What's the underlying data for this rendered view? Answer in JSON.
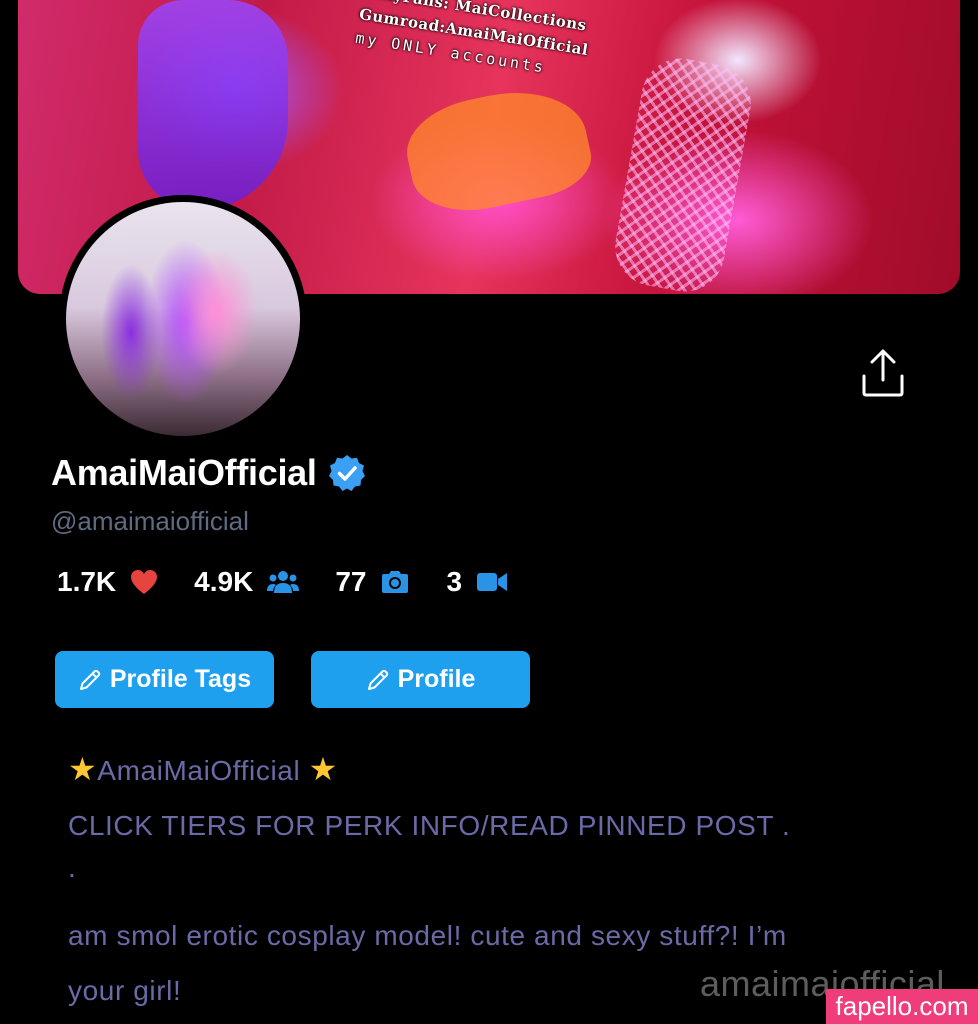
{
  "cover": {
    "lines": [
      "OnlyFans: MaiCollections",
      "Gumroad:AmaiMaiOfficial",
      "my ONLY accounts"
    ]
  },
  "profile": {
    "display_name": "AmaiMaiOfficial",
    "handle": "@amaimaiofficial",
    "verified": true
  },
  "stats": {
    "likes": "1.7K",
    "subscribers": "4.9K",
    "photos": "77",
    "videos": "3"
  },
  "buttons": {
    "profile_tags": "Profile Tags",
    "profile": "Profile"
  },
  "bio": {
    "title": "AmaiMaiOfficial",
    "line1": "CLICK TIERS FOR PERK INFO/READ PINNED POST .",
    "line2": ".",
    "line3": "am smol erotic cosplay model! cute and sexy stuff?! I’m",
    "line4": "your girl!"
  },
  "watermark": {
    "text": "amaimaiofficial",
    "badge": "fapello.com"
  },
  "colors": {
    "accent": "#1ea0ef",
    "bio_text": "#6a6aa6",
    "handle": "#5f6b80",
    "heart": "#e8443f",
    "star": "#ffc633",
    "watermark_badge": "#ee3d7a"
  }
}
